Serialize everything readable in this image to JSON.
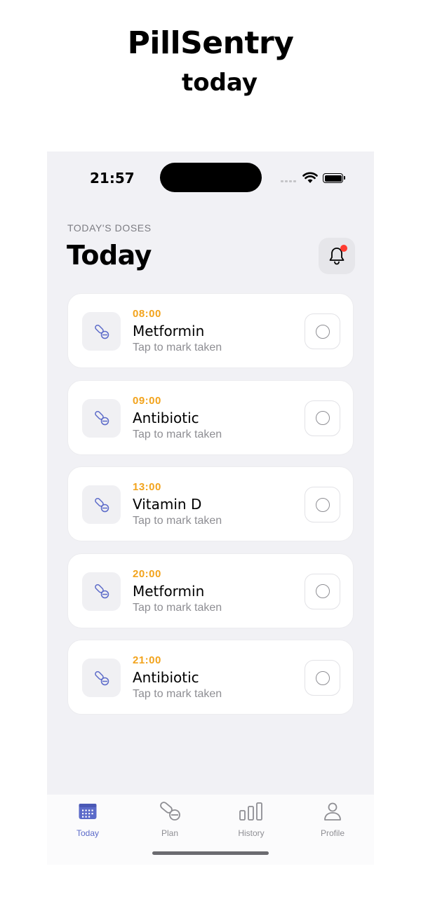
{
  "promo": {
    "title": "PillSentry",
    "subtitle": "today"
  },
  "status_bar": {
    "time": "21:57"
  },
  "header": {
    "overline": "TODAY'S DOSES",
    "title": "Today",
    "bell_icon": "bell-icon",
    "has_notification": true
  },
  "doses": [
    {
      "time": "08:00",
      "name": "Metformin",
      "hint": "Tap to mark taken"
    },
    {
      "time": "09:00",
      "name": "Antibiotic",
      "hint": "Tap to mark taken"
    },
    {
      "time": "13:00",
      "name": "Vitamin D",
      "hint": "Tap to mark taken"
    },
    {
      "time": "20:00",
      "name": "Metformin",
      "hint": "Tap to mark taken"
    },
    {
      "time": "21:00",
      "name": "Antibiotic",
      "hint": "Tap to mark taken"
    }
  ],
  "tabs": [
    {
      "label": "Today",
      "icon": "calendar-icon",
      "active": true
    },
    {
      "label": "Plan",
      "icon": "pill-icon",
      "active": false
    },
    {
      "label": "History",
      "icon": "bar-chart-icon",
      "active": false
    },
    {
      "label": "Profile",
      "icon": "person-icon",
      "active": false
    }
  ],
  "colors": {
    "accent": "#5b6ac9",
    "time_orange": "#f2a31c",
    "notification_red": "#ff3b30",
    "background": "#f1f1f5"
  }
}
